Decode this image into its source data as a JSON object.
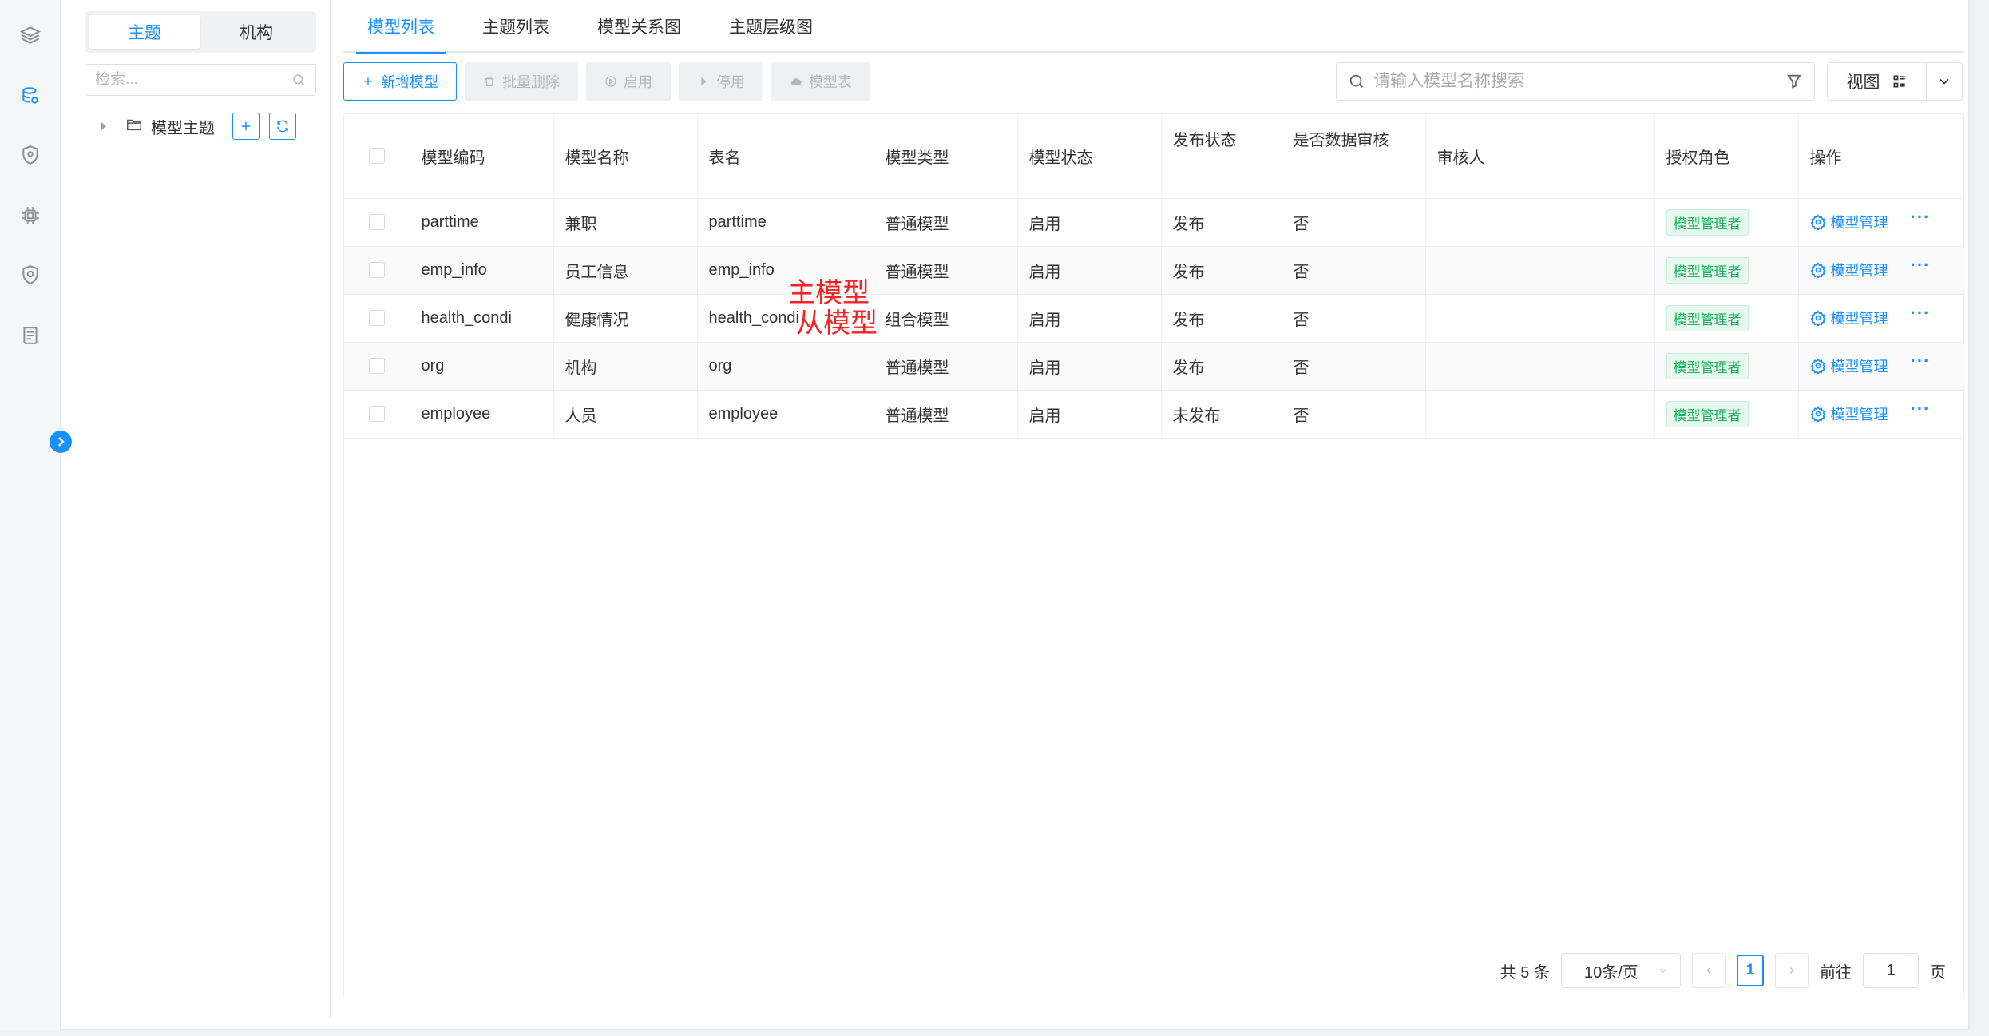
{
  "rail": {
    "icons": [
      "layers-icon",
      "database-icon",
      "shield-icon",
      "chip-icon",
      "security-icon",
      "document-icon"
    ],
    "active_index": 1
  },
  "side": {
    "segments": [
      "主题",
      "机构"
    ],
    "active_segment": 0,
    "search_placeholder": "检索...",
    "tree": [
      {
        "label": "模型主题"
      }
    ]
  },
  "tabs": [
    "模型列表",
    "主题列表",
    "模型关系图",
    "主题层级图"
  ],
  "toolbar": {
    "add": "新增模型",
    "batch_delete": "批量删除",
    "enable": "启用",
    "disable": "停用",
    "model_table": "模型表"
  },
  "search": {
    "placeholder": "请输入模型名称搜索"
  },
  "view": {
    "label": "视图"
  },
  "table": {
    "headers": [
      "模型编码",
      "模型名称",
      "表名",
      "模型类型",
      "模型状态",
      "发布状态",
      "是否数据审核",
      "审核人",
      "授权角色",
      "操作"
    ],
    "rows": [
      {
        "code": "parttime",
        "name": "兼职",
        "table": "parttime",
        "type": "普通模型",
        "status": "启用",
        "publish": "发布",
        "audit": "否",
        "auditor": "",
        "role": "模型管理者",
        "action": "模型管理"
      },
      {
        "code": "emp_info",
        "name": "员工信息",
        "table": "emp_info",
        "type": "普通模型",
        "status": "启用",
        "publish": "发布",
        "audit": "否",
        "auditor": "",
        "role": "模型管理者",
        "action": "模型管理"
      },
      {
        "code": "health_condi",
        "name": "健康情况",
        "table": "health_condi",
        "type": "组合模型",
        "status": "启用",
        "publish": "发布",
        "audit": "否",
        "auditor": "",
        "role": "模型管理者",
        "action": "模型管理"
      },
      {
        "code": "org",
        "name": "机构",
        "table": "org",
        "type": "普通模型",
        "status": "启用",
        "publish": "发布",
        "audit": "否",
        "auditor": "",
        "role": "模型管理者",
        "action": "模型管理"
      },
      {
        "code": "employee",
        "name": "人员",
        "table": "employee",
        "type": "普通模型",
        "status": "启用",
        "publish": "未发布",
        "audit": "否",
        "auditor": "",
        "role": "模型管理者",
        "action": "模型管理"
      }
    ],
    "more_label": "···"
  },
  "annotations": {
    "main_model": "主模型",
    "sub_model": "从模型"
  },
  "pager": {
    "total": "共 5 条",
    "page_size": "10条/页",
    "current": "1",
    "goto_label": "前往",
    "goto_value": "1",
    "page_unit": "页"
  },
  "colors": {
    "accent": "#1890ff",
    "annotation": "#f52222",
    "badge_text": "#19b25e"
  }
}
